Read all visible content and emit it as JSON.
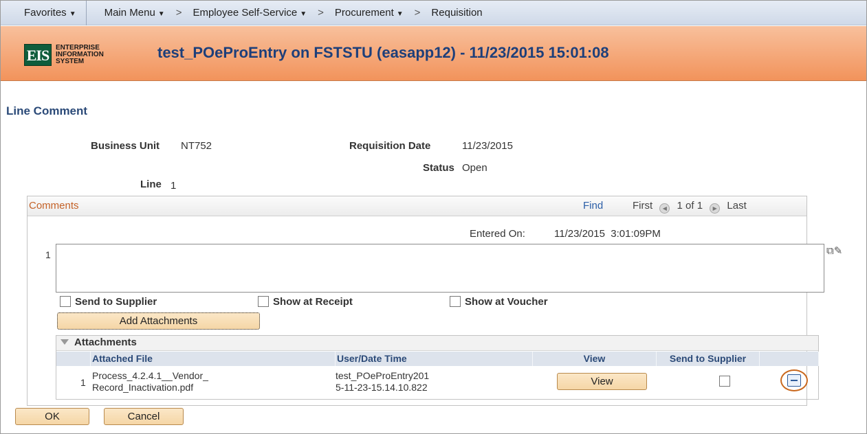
{
  "nav": {
    "favorites": "Favorites",
    "main_menu": "Main Menu",
    "sep": ">",
    "ess": "Employee Self-Service",
    "procurement": "Procurement",
    "requisition": "Requisition"
  },
  "banner": {
    "logo_mark": "EIS",
    "logo_line1": "ENTERPRISE",
    "logo_line2": "INFORMATION",
    "logo_line3": "SYSTEM",
    "title": "test_POeProEntry on FSTSTU (easapp12) - 11/23/2015 15:01:08"
  },
  "page": {
    "title": "Line Comment",
    "business_unit_label": "Business Unit",
    "business_unit": "NT752",
    "req_date_label": "Requisition Date",
    "req_date": "11/23/2015",
    "status_label": "Status",
    "status": "Open",
    "line_label": "Line",
    "line": "1"
  },
  "comments": {
    "title": "Comments",
    "find": "Find",
    "first": "First",
    "range": "1 of 1",
    "last": "Last",
    "row": "1",
    "entered_on_label": "Entered On:",
    "entered_on": "11/23/2015  3:01:09PM",
    "comment_text": "",
    "send_to_supplier": "Send to Supplier",
    "show_at_receipt": "Show at Receipt",
    "show_at_voucher": "Show at Voucher",
    "add_attachments": "Add Attachments"
  },
  "attachments": {
    "title": "Attachments",
    "columns": [
      "Attached File",
      "User/Date Time",
      "View",
      "Send to Supplier"
    ],
    "rows": [
      {
        "num": "1",
        "file_line1": "Process_4.2.4.1__Vendor_",
        "file_line2": "Record_Inactivation.pdf",
        "user_line1": "test_POeProEntry201",
        "user_line2": "5-11-23-15.14.10.822",
        "view": "View"
      }
    ]
  },
  "buttons": {
    "ok": "OK",
    "cancel": "Cancel"
  },
  "colors": {
    "banner": "#f2935b",
    "title_blue": "#1d3f7a",
    "button_bg": "#f5d6a6"
  }
}
